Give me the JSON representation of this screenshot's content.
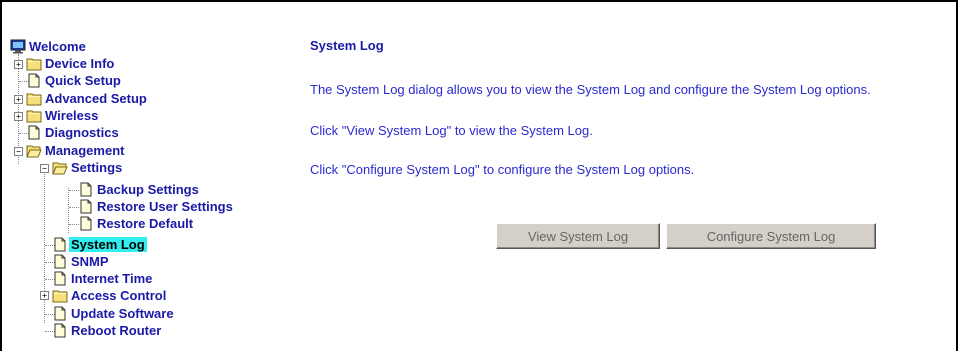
{
  "tree": {
    "welcome": "Welcome",
    "device_info": "Device Info",
    "quick_setup": "Quick Setup",
    "advanced_setup": "Advanced Setup",
    "wireless": "Wireless",
    "diagnostics": "Diagnostics",
    "management": "Management",
    "settings": "Settings",
    "backup_settings": "Backup Settings",
    "restore_user_settings": "Restore User Settings",
    "restore_default": "Restore Default",
    "system_log": "System Log",
    "snmp": "SNMP",
    "internet_time": "Internet Time",
    "access_control": "Access Control",
    "update_software": "Update Software",
    "reboot_router": "Reboot Router",
    "expand_symbol": "+",
    "collapse_symbol": "−"
  },
  "main": {
    "title": "System Log",
    "para1": "The System Log dialog allows you to view the System Log and configure the System Log options.",
    "para2": "Click \"View System Log\" to view the System Log.",
    "para3": "Click \"Configure System Log\" to configure the System Log options.",
    "view_button": "View System Log",
    "configure_button": "Configure System Log"
  },
  "colors": {
    "link": "#1a1aa6",
    "selected_highlight": "#33eeee",
    "button_face": "#d4d0c8"
  }
}
